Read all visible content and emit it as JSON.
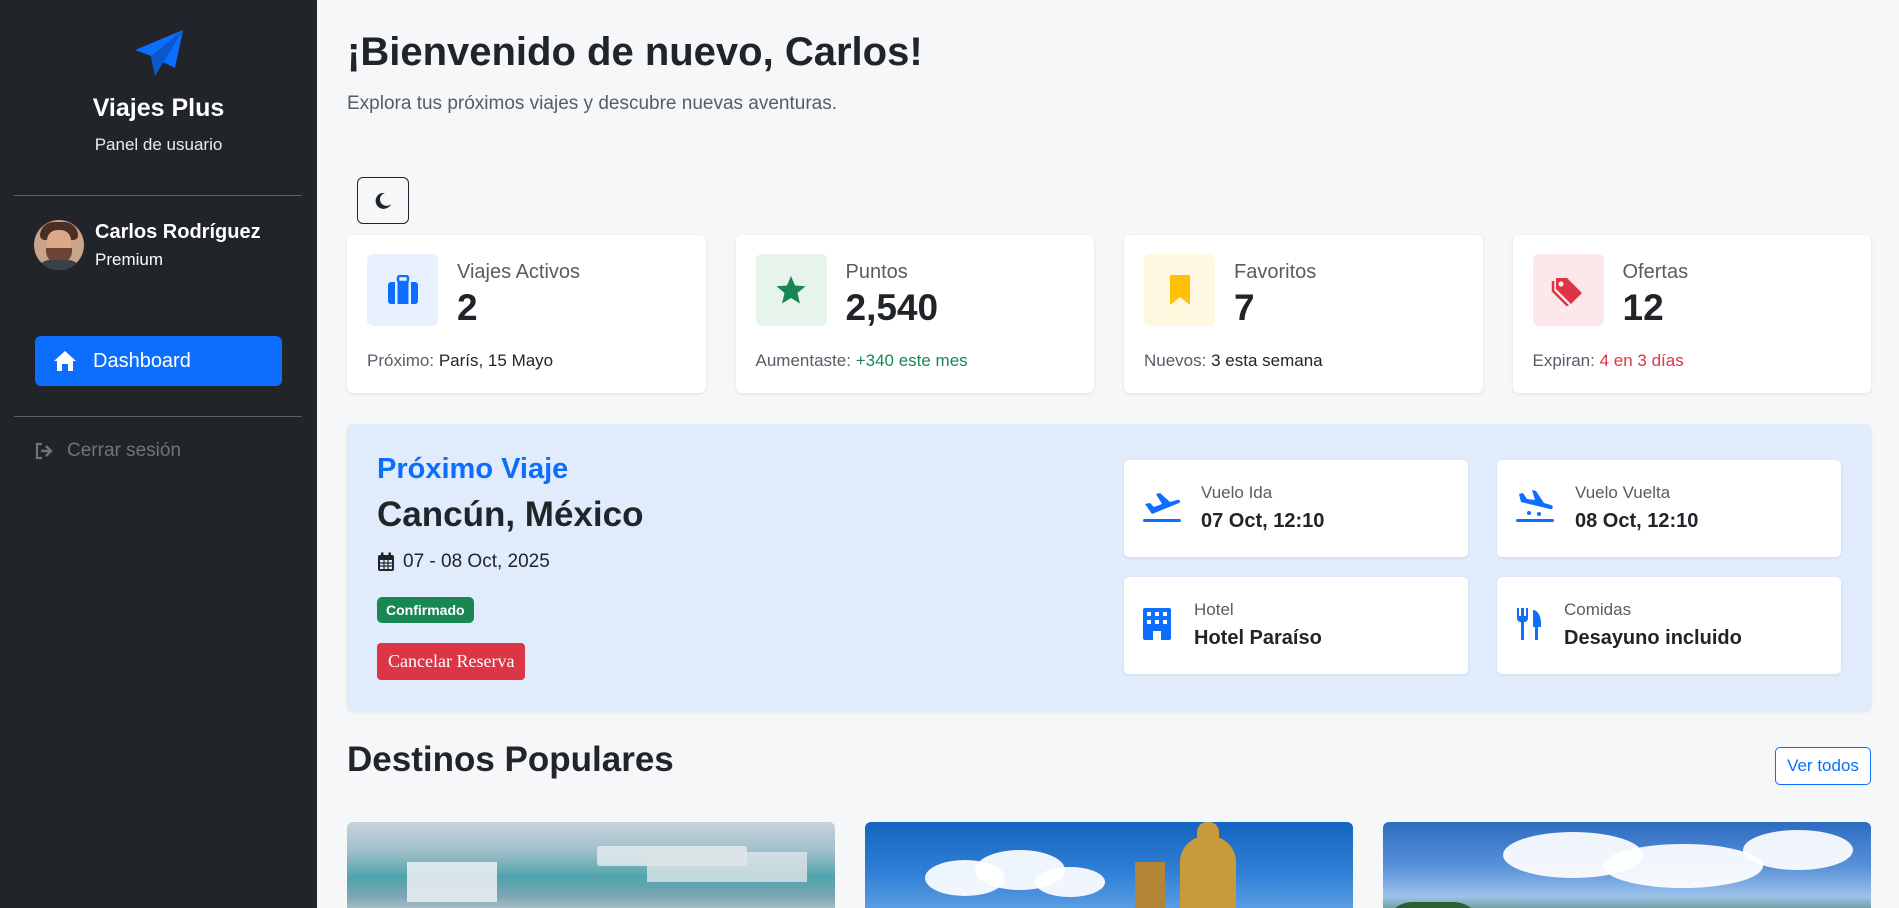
{
  "sidebar": {
    "brand_name": "Viajes Plus",
    "brand_sub": "Panel de usuario",
    "user_name": "Carlos Rodríguez",
    "user_tier": "Premium",
    "nav_dashboard": "Dashboard",
    "logout": "Cerrar sesión"
  },
  "header": {
    "title": "¡Bienvenido de nuevo, Carlos!",
    "subtitle": "Explora tus próximos viajes y descubre nuevas aventuras."
  },
  "stats": [
    {
      "label": "Viajes Activos",
      "value": "2",
      "foot_label": "Próximo:",
      "foot_value": "París, 15 Mayo",
      "icon": "suitcase-icon",
      "color": "#0d6efd",
      "bg": "#e6f0ff",
      "foot_color": "#212529"
    },
    {
      "label": "Puntos",
      "value": "2,540",
      "foot_label": "Aumentaste:",
      "foot_value": "+340 este mes",
      "icon": "star-icon",
      "color": "#198754",
      "bg": "#e7f4ec",
      "foot_color": "#198754"
    },
    {
      "label": "Favoritos",
      "value": "7",
      "foot_label": "Nuevos:",
      "foot_value": "3 esta semana",
      "icon": "bookmark-icon",
      "color": "#ffc107",
      "bg": "#fff8e1",
      "foot_color": "#212529"
    },
    {
      "label": "Ofertas",
      "value": "12",
      "foot_label": "Expiran:",
      "foot_value": "4 en 3 días",
      "icon": "tags-icon",
      "color": "#dc3545",
      "bg": "#fce8ea",
      "foot_color": "#dc3545"
    }
  ],
  "trip": {
    "tag": "Próximo Viaje",
    "destination": "Cancún, México",
    "dates": "07 - 08 Oct, 2025",
    "status": "Confirmado",
    "cancel_label": "Cancelar Reserva",
    "flight_out_label": "Vuelo Ida",
    "flight_out_value": "07 Oct, 12:10",
    "flight_back_label": "Vuelo Vuelta",
    "flight_back_value": "08 Oct, 12:10",
    "hotel_label": "Hotel",
    "hotel_value": "Hotel Paraíso",
    "meals_label": "Comidas",
    "meals_value": "Desayuno incluido"
  },
  "destinations": {
    "title": "Destinos Populares",
    "view_all": "Ver todos"
  },
  "colors": {
    "sidebar_bg": "#212529",
    "primary": "#0d6efd",
    "success": "#198754",
    "danger": "#dc3545",
    "warning": "#ffc107",
    "trip_bg": "#e0ebfb"
  }
}
